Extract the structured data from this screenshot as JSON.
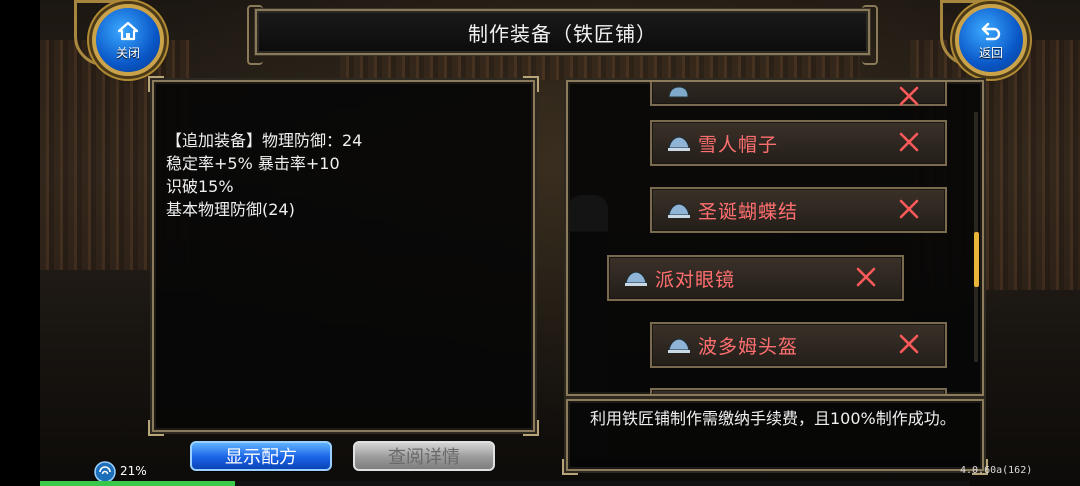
{
  "header": {
    "title": "制作装备（铁匠铺）",
    "close_label": "关闭",
    "back_label": "返回"
  },
  "description": {
    "lines": [
      "【追加装备】物理防御：24",
      "稳定率+5% 暴击率+10",
      "识破15%",
      "基本物理防御(24)"
    ]
  },
  "recipe_list": {
    "items": [
      {
        "name": "雪人帽子",
        "selected": false
      },
      {
        "name": "圣诞蝴蝶结",
        "selected": false
      },
      {
        "name": "派对眼镜",
        "selected": true
      },
      {
        "name": "波多姆头盔",
        "selected": false
      }
    ],
    "name_color": "#ff6f6f"
  },
  "info": {
    "text": "利用铁匠铺制作需缴纳手续费，且100%制作成功。"
  },
  "buttons": {
    "show_recipe": "显示配方",
    "view_detail": "查阅详情"
  },
  "status": {
    "percent_label": "21%",
    "progress": 0.21,
    "version": "4.0.60a(162)"
  },
  "colors": {
    "accent_blue": "#1a63e6",
    "frame_gold": "#c9a24a",
    "close_x": "#ff5a5a"
  }
}
